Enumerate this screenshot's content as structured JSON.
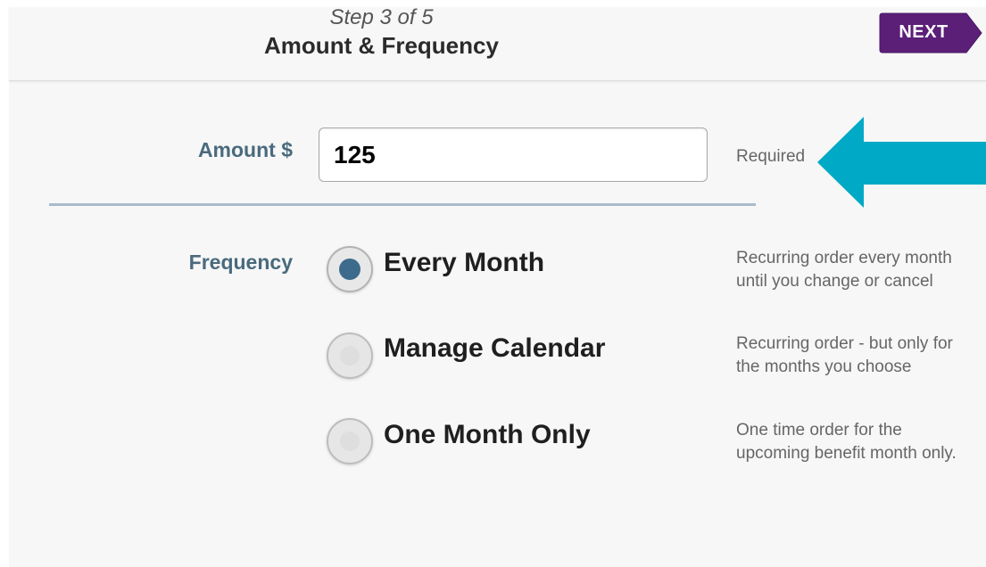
{
  "header": {
    "step": "Step 3 of 5",
    "title": "Amount & Frequency",
    "next_label": "NEXT"
  },
  "amount": {
    "label": "Amount $",
    "value": "125",
    "required_text": "Required"
  },
  "frequency": {
    "label": "Frequency",
    "selected": "Every Month",
    "options": [
      {
        "label": "Every Month",
        "description_line1": "Recurring order every month",
        "description_line2": "until you change or cancel",
        "selected": true
      },
      {
        "label": "Manage Calendar",
        "description_line1": "Recurring order - but only for",
        "description_line2": "the months you choose",
        "selected": false
      },
      {
        "label": "One Month Only",
        "description_line1": "One time order for the",
        "description_line2": "upcoming benefit month only.",
        "selected": false
      }
    ]
  },
  "colors": {
    "next_button": "#5b1f78",
    "label_text": "#4a6a7d",
    "radio_selected": "#3d6b8c",
    "annotation_arrow": "#00a9c5",
    "divider": "#a9bccb"
  },
  "icons": {
    "annotation": "arrow-left-icon",
    "radio_selected": "radio-selected-icon",
    "radio_unselected": "radio-unselected-icon"
  }
}
